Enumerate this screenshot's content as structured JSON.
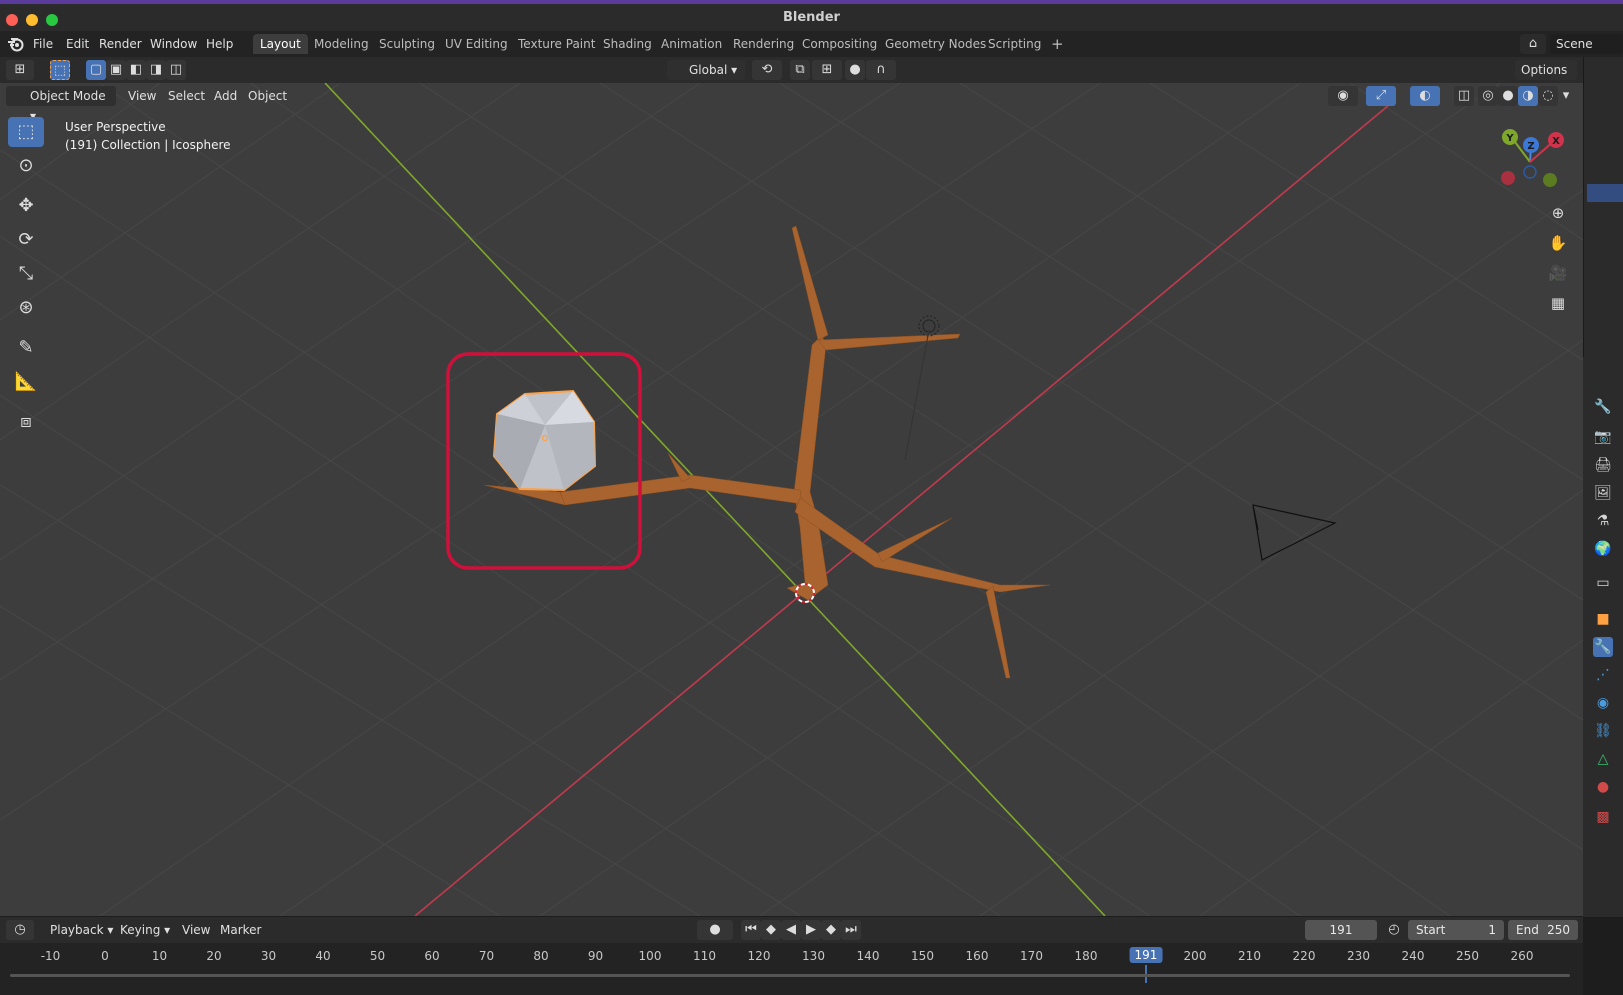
{
  "app": {
    "title": "Blender"
  },
  "menu": {
    "file": "File",
    "edit": "Edit",
    "render": "Render",
    "window": "Window",
    "help": "Help"
  },
  "workspaces": [
    "Layout",
    "Modeling",
    "Sculpting",
    "UV Editing",
    "Texture Paint",
    "Shading",
    "Animation",
    "Rendering",
    "Compositing",
    "Geometry Nodes",
    "Scripting"
  ],
  "active_workspace": "Layout",
  "scene": {
    "label": "Scene"
  },
  "tool_header": {
    "transform_orientation": "Global",
    "options": "Options"
  },
  "viewport_header": {
    "mode": "Object Mode",
    "view": "View",
    "select": "Select",
    "add": "Add",
    "object": "Object"
  },
  "overlay": {
    "perspective": "User Perspective",
    "context": "(191) Collection | Icosphere"
  },
  "gizmo": {
    "x": "X",
    "y": "Y",
    "z": "Z"
  },
  "timeline": {
    "playback": "Playback",
    "keying": "Keying",
    "view": "View",
    "marker": "Marker",
    "current_frame": "191",
    "start_label": "Start",
    "start": "1",
    "end_label": "End",
    "end": "250",
    "ticks": [
      "-10",
      "0",
      "10",
      "20",
      "30",
      "40",
      "50",
      "60",
      "70",
      "80",
      "90",
      "100",
      "110",
      "120",
      "130",
      "140",
      "150",
      "160",
      "170",
      "180",
      "191",
      "200",
      "210",
      "220",
      "230",
      "240",
      "250",
      "260"
    ]
  },
  "colors": {
    "accent": "#4772b3",
    "selection": "#ffa142",
    "highlight_box": "#d0103a",
    "axis_x": "#c23a4e",
    "axis_y": "#7fa82a",
    "branch": "#a9632e"
  }
}
